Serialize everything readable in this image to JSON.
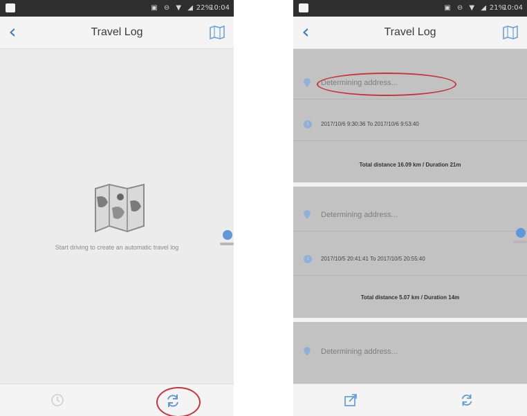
{
  "left_screen": {
    "status_bar": {
      "icons": "▣ ⊖ ▼ ◢",
      "battery": "22%",
      "time": "10:04"
    },
    "title": "Travel Log",
    "empty_message": "Start driving to create an automatic travel log"
  },
  "right_screen": {
    "status_bar": {
      "icons": "▣ ⊖ ▼ ◢",
      "battery": "21%",
      "time": "10:04"
    },
    "title": "Travel Log",
    "trips": [
      {
        "address": "Determining address...",
        "time_range": "2017/10/6 9:30:36 To 2017/10/6 9:53:40",
        "summary": "Total distance 16.09 km / Duration 21m"
      },
      {
        "address": "Determining address...",
        "time_range": "2017/10/5 20:41:41 To 2017/10/5 20:55:40",
        "summary": "Total distance 5.07 km / Duration 14m"
      },
      {
        "address": "Determining address...",
        "time_range": "",
        "summary": ""
      }
    ]
  },
  "colors": {
    "accent_blue": "#2f78c8",
    "highlight_red": "#c8333a",
    "status_bar": "#2e2e2e",
    "card_gray": "#c2c2c2"
  },
  "icons": {
    "back": "chevron-left-icon",
    "map": "folded-map-icon",
    "history": "clock-history-icon",
    "refresh": "refresh-icon",
    "share": "share-icon",
    "pin": "location-pin-icon",
    "clock": "clock-icon"
  }
}
